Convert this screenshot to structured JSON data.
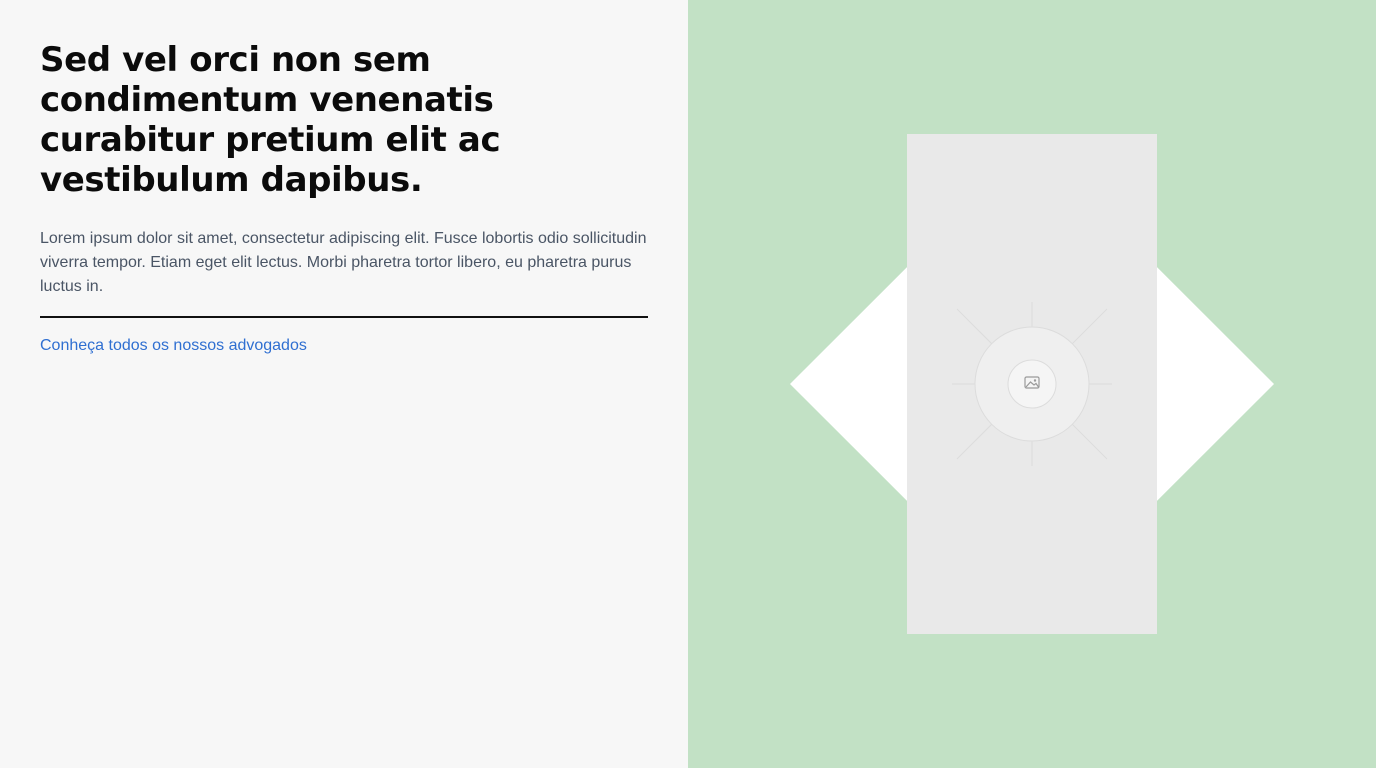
{
  "hero": {
    "headline": "Sed vel orci non sem condimentum venenatis curabitur pretium elit ac vestibulum dapibus.",
    "description": "Lorem ipsum dolor sit amet, consectetur adipiscing elit. Fusce lobortis odio sollicitudin viverra tempor. Etiam eget elit lectus. Morbi pharetra tortor libero, eu pharetra purus luctus in.",
    "cta_label": "Conheça todos os nossos advogados"
  },
  "visual": {
    "placeholder_icon": "image-icon"
  },
  "colors": {
    "left_background": "#f7f7f7",
    "right_background": "#c2e1c5",
    "diamond": "#ffffff",
    "placeholder": "#e9e9e9",
    "link": "#2f6fd1",
    "headline": "#0b0b0b",
    "body_text": "#4a5565"
  }
}
